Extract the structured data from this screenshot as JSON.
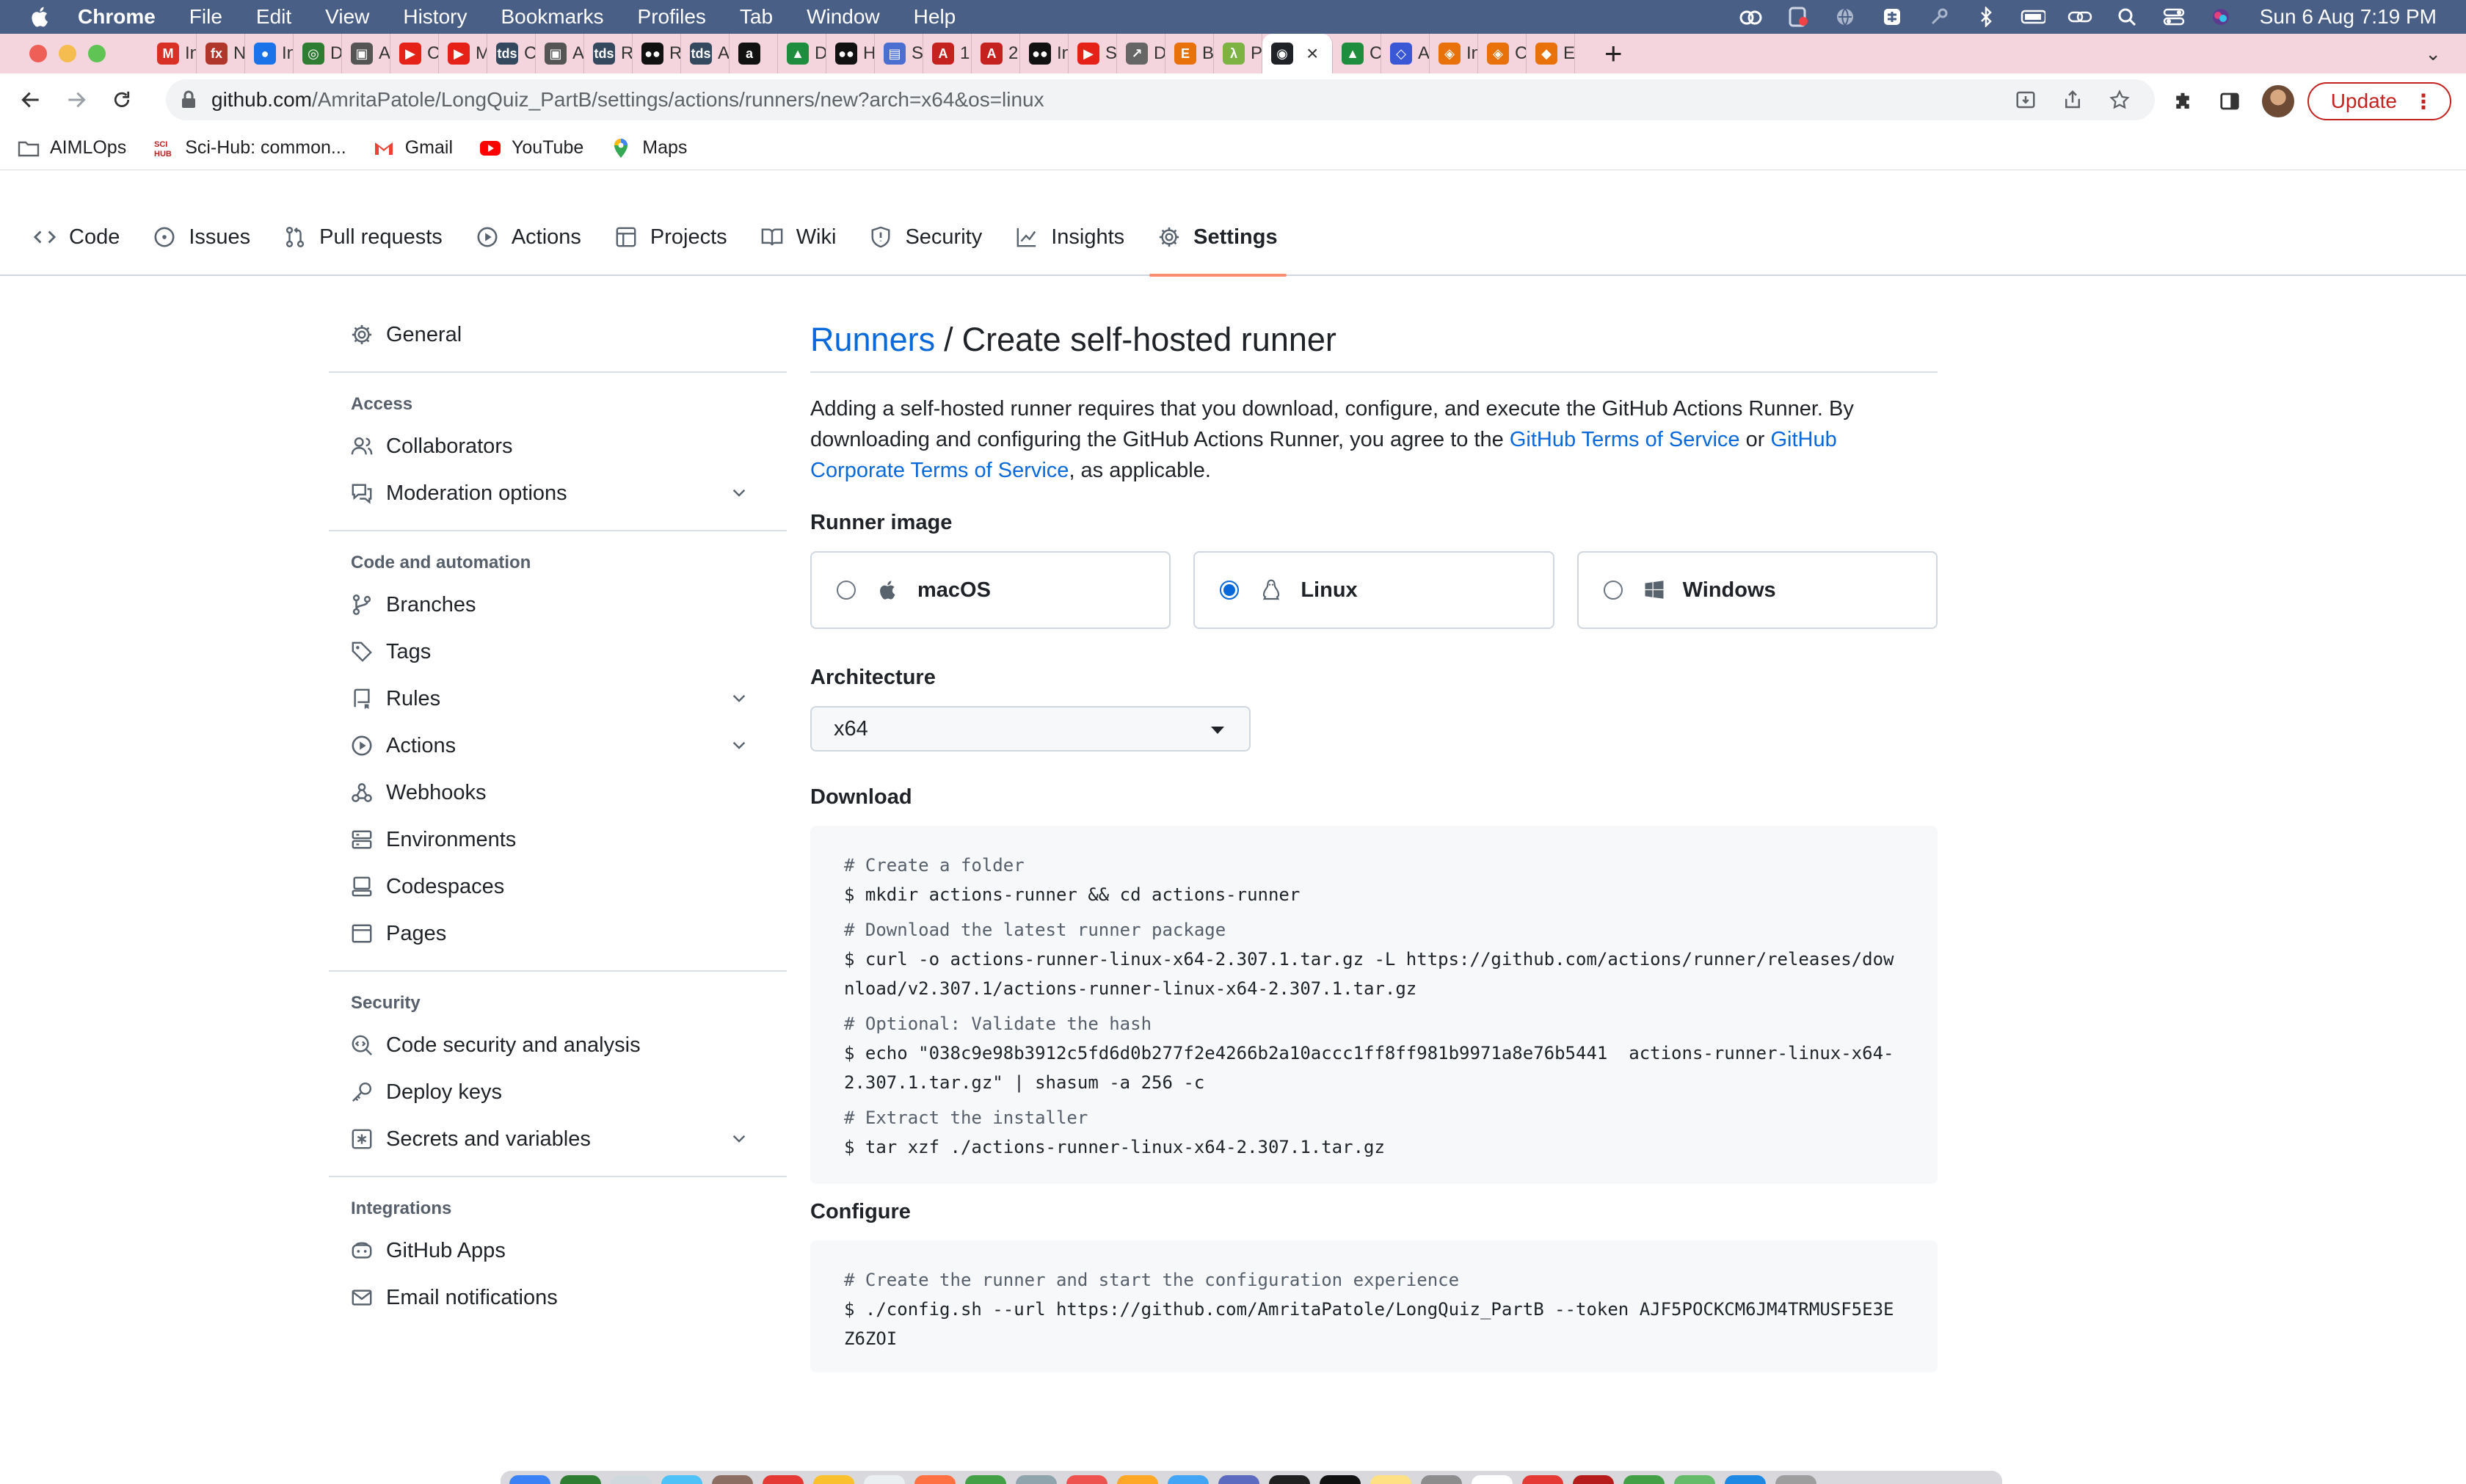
{
  "menubar": {
    "app_name": "Chrome",
    "menus": [
      "File",
      "Edit",
      "View",
      "History",
      "Bookmarks",
      "Profiles",
      "Tab",
      "Window",
      "Help"
    ],
    "clock": "Sun 6 Aug  7:19 PM"
  },
  "tabs": [
    {
      "label": "In",
      "color": "#d93025",
      "glyph": "M"
    },
    {
      "label": "N",
      "color": "#b0362c",
      "glyph": "fx"
    },
    {
      "label": "In",
      "color": "#1a73e8",
      "glyph": "●"
    },
    {
      "label": "D",
      "color": "#2e7d32",
      "glyph": "◎"
    },
    {
      "label": "A",
      "color": "#555555",
      "glyph": "▣"
    },
    {
      "label": "C",
      "color": "#e62117",
      "glyph": "▶"
    },
    {
      "label": "M",
      "color": "#e62117",
      "glyph": "▶"
    },
    {
      "label": "C",
      "color": "#34495e",
      "glyph": "tds"
    },
    {
      "label": "A",
      "color": "#555555",
      "glyph": "▣"
    },
    {
      "label": "R",
      "color": "#34495e",
      "glyph": "tds"
    },
    {
      "label": "R",
      "color": "#111111",
      "glyph": "●●"
    },
    {
      "label": "A",
      "color": "#34495e",
      "glyph": "tds"
    },
    {
      "label": "",
      "color": "#111111",
      "glyph": "a"
    },
    {
      "label": "D",
      "color": "#1e8e3e",
      "glyph": "▲"
    },
    {
      "label": "H",
      "color": "#111111",
      "glyph": "●●"
    },
    {
      "label": "S",
      "color": "#4a6fd1",
      "glyph": "▤"
    },
    {
      "label": "1!",
      "color": "#c5221f",
      "glyph": "A"
    },
    {
      "label": "2!",
      "color": "#c5221f",
      "glyph": "A"
    },
    {
      "label": "In",
      "color": "#111111",
      "glyph": "●●"
    },
    {
      "label": "S",
      "color": "#e62117",
      "glyph": "▶"
    },
    {
      "label": "D",
      "color": "#666666",
      "glyph": "↗"
    },
    {
      "label": "B",
      "color": "#e8710a",
      "glyph": "E"
    },
    {
      "label": "P",
      "color": "#7cb342",
      "glyph": "λ"
    },
    {
      "label": "",
      "color": "#1f2328",
      "glyph": "◉",
      "active": true
    },
    {
      "label": "C",
      "color": "#1e8e3e",
      "glyph": "▲"
    },
    {
      "label": "A",
      "color": "#3a57d6",
      "glyph": "◇"
    },
    {
      "label": "In",
      "color": "#e8710a",
      "glyph": "◈"
    },
    {
      "label": "C",
      "color": "#e8710a",
      "glyph": "◈"
    },
    {
      "label": "E",
      "color": "#e8710a",
      "glyph": "◆"
    }
  ],
  "toolbar": {
    "url_host": "github.com",
    "url_path": "/AmritaPatole/LongQuiz_PartB/settings/actions/runners/new?arch=x64&os=linux",
    "update_label": "Update"
  },
  "bookmarks": [
    {
      "label": "AIMLOps",
      "icon": "folder-icon"
    },
    {
      "label": "Sci-Hub: common...",
      "icon": "scihub-icon"
    },
    {
      "label": "Gmail",
      "icon": "gmail-icon"
    },
    {
      "label": "YouTube",
      "icon": "youtube-icon"
    },
    {
      "label": "Maps",
      "icon": "maps-icon"
    }
  ],
  "repo_nav": [
    {
      "label": "Code",
      "icon": "code-icon"
    },
    {
      "label": "Issues",
      "icon": "issue-icon"
    },
    {
      "label": "Pull requests",
      "icon": "pull-request-icon"
    },
    {
      "label": "Actions",
      "icon": "play-icon"
    },
    {
      "label": "Projects",
      "icon": "table-icon"
    },
    {
      "label": "Wiki",
      "icon": "book-icon"
    },
    {
      "label": "Security",
      "icon": "shield-icon"
    },
    {
      "label": "Insights",
      "icon": "graph-icon"
    },
    {
      "label": "Settings",
      "icon": "gear-icon",
      "selected": true
    }
  ],
  "sidebar": {
    "general": "General",
    "access_heading": "Access",
    "collaborators": "Collaborators",
    "moderation": "Moderation options",
    "code_heading": "Code and automation",
    "branches": "Branches",
    "tags": "Tags",
    "rules": "Rules",
    "actions": "Actions",
    "webhooks": "Webhooks",
    "environments": "Environments",
    "codespaces": "Codespaces",
    "pages": "Pages",
    "security_heading": "Security",
    "code_security": "Code security and analysis",
    "deploy_keys": "Deploy keys",
    "secrets": "Secrets and variables",
    "integrations_heading": "Integrations",
    "github_apps": "GitHub Apps",
    "email_notifications": "Email notifications"
  },
  "main": {
    "breadcrumb_link": "Runners",
    "breadcrumb_sep": "/",
    "title": "Create self-hosted runner",
    "intro_1": "Adding a self-hosted runner requires that you download, configure, and execute the GitHub Actions Runner. By downloading and configuring the GitHub Actions Runner, you agree to the ",
    "terms_link": "GitHub Terms of Service",
    "intro_or": " or ",
    "corp_terms_link": "GitHub Corporate Terms of Service",
    "intro_2": ", as applicable.",
    "runner_image_heading": "Runner image",
    "os_options": [
      {
        "label": "macOS",
        "checked": false
      },
      {
        "label": "Linux",
        "checked": true
      },
      {
        "label": "Windows",
        "checked": false
      }
    ],
    "architecture_heading": "Architecture",
    "architecture_value": "x64",
    "download_heading": "Download",
    "download_lines": [
      {
        "type": "comment",
        "text": "# Create a folder"
      },
      {
        "type": "cmd",
        "text": "$ mkdir actions-runner && cd actions-runner"
      },
      {
        "type": "comment",
        "text": "# Download the latest runner package"
      },
      {
        "type": "cmd",
        "text": "$ curl -o actions-runner-linux-x64-2.307.1.tar.gz -L https://github.com/actions/runner/releases/download/v2.307.1/actions-runner-linux-x64-2.307.1.tar.gz"
      },
      {
        "type": "comment",
        "text": "# Optional: Validate the hash"
      },
      {
        "type": "cmd",
        "text": "$ echo \"038c9e98b3912c5fd6d0b277f2e4266b2a10accc1ff8ff981b9971a8e76b5441  actions-runner-linux-x64-2.307.1.tar.gz\" | shasum -a 256 -c"
      },
      {
        "type": "comment",
        "text": "# Extract the installer"
      },
      {
        "type": "cmd",
        "text": "$ tar xzf ./actions-runner-linux-x64-2.307.1.tar.gz"
      }
    ],
    "configure_heading": "Configure",
    "configure_lines": [
      {
        "type": "comment",
        "text": "# Create the runner and start the configuration experience"
      },
      {
        "type": "cmd",
        "text": "$ ./config.sh --url https://github.com/AmritaPatole/LongQuiz_PartB --token AJF5POCKCM6JM4TRMUSF5E3EZ6ZOI"
      }
    ]
  },
  "colors": {
    "link": "#0969da",
    "selected_underline": "#fd8c73",
    "menubar": "#4a5f86",
    "tabstrip": "#f4d5de"
  }
}
